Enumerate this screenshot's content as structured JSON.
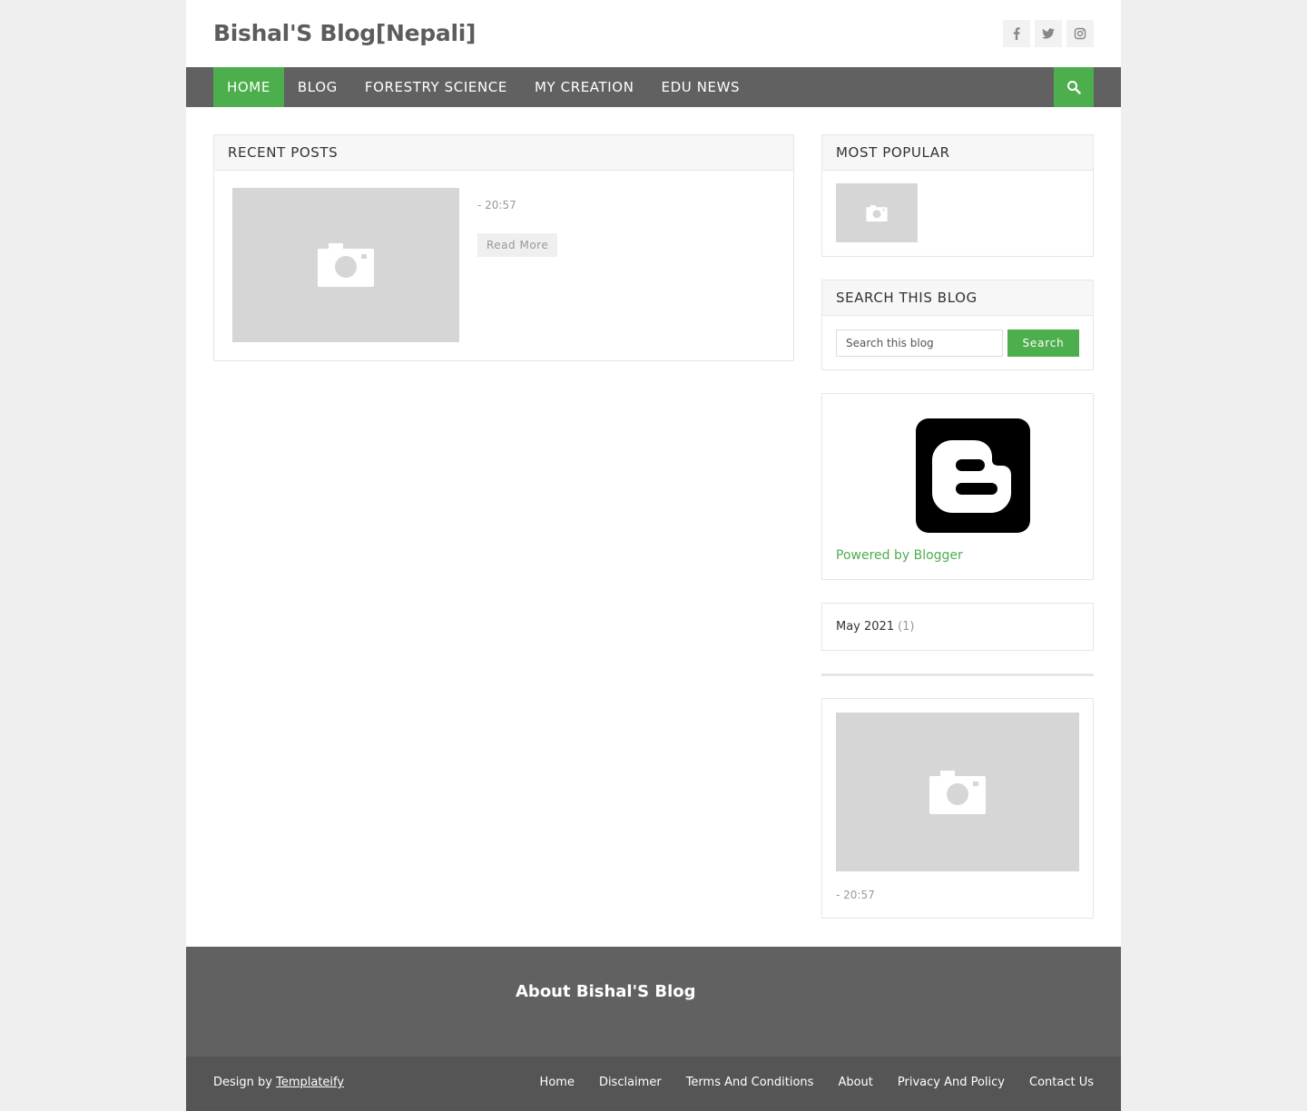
{
  "site": {
    "title": "Bishal'S Blog[Nepali]"
  },
  "socials": [
    "facebook-icon",
    "twitter-icon",
    "instagram-icon"
  ],
  "nav": {
    "items": [
      {
        "label": "Home",
        "active": true
      },
      {
        "label": "Blog"
      },
      {
        "label": "Forestry Science"
      },
      {
        "label": "My Creation"
      },
      {
        "label": "Edu News"
      }
    ]
  },
  "recent_posts": {
    "title": "Recent Posts",
    "post": {
      "meta": "- 20:57",
      "read_more": "Read More"
    }
  },
  "most_popular": {
    "title": "Most Popular"
  },
  "search_widget": {
    "title": "Search This Blog",
    "placeholder": "Search this blog",
    "button": "Search"
  },
  "blogger_widget": {
    "link": "Powered by Blogger"
  },
  "archive": {
    "month": "May 2021",
    "count": "(1)"
  },
  "featured": {
    "meta": "- 20:57"
  },
  "footer": {
    "about_title": "About Bishal'S Blog",
    "credit_prefix": "Design by",
    "credit_link": "Templateify",
    "links": [
      "Home",
      "Disclaimer",
      "Terms And Conditions",
      "About",
      "Privacy And Policy",
      "Contact Us"
    ]
  },
  "colors": {
    "accent": "#4cae4c",
    "nav_bg": "#616161",
    "footer_bottom": "#555555"
  }
}
